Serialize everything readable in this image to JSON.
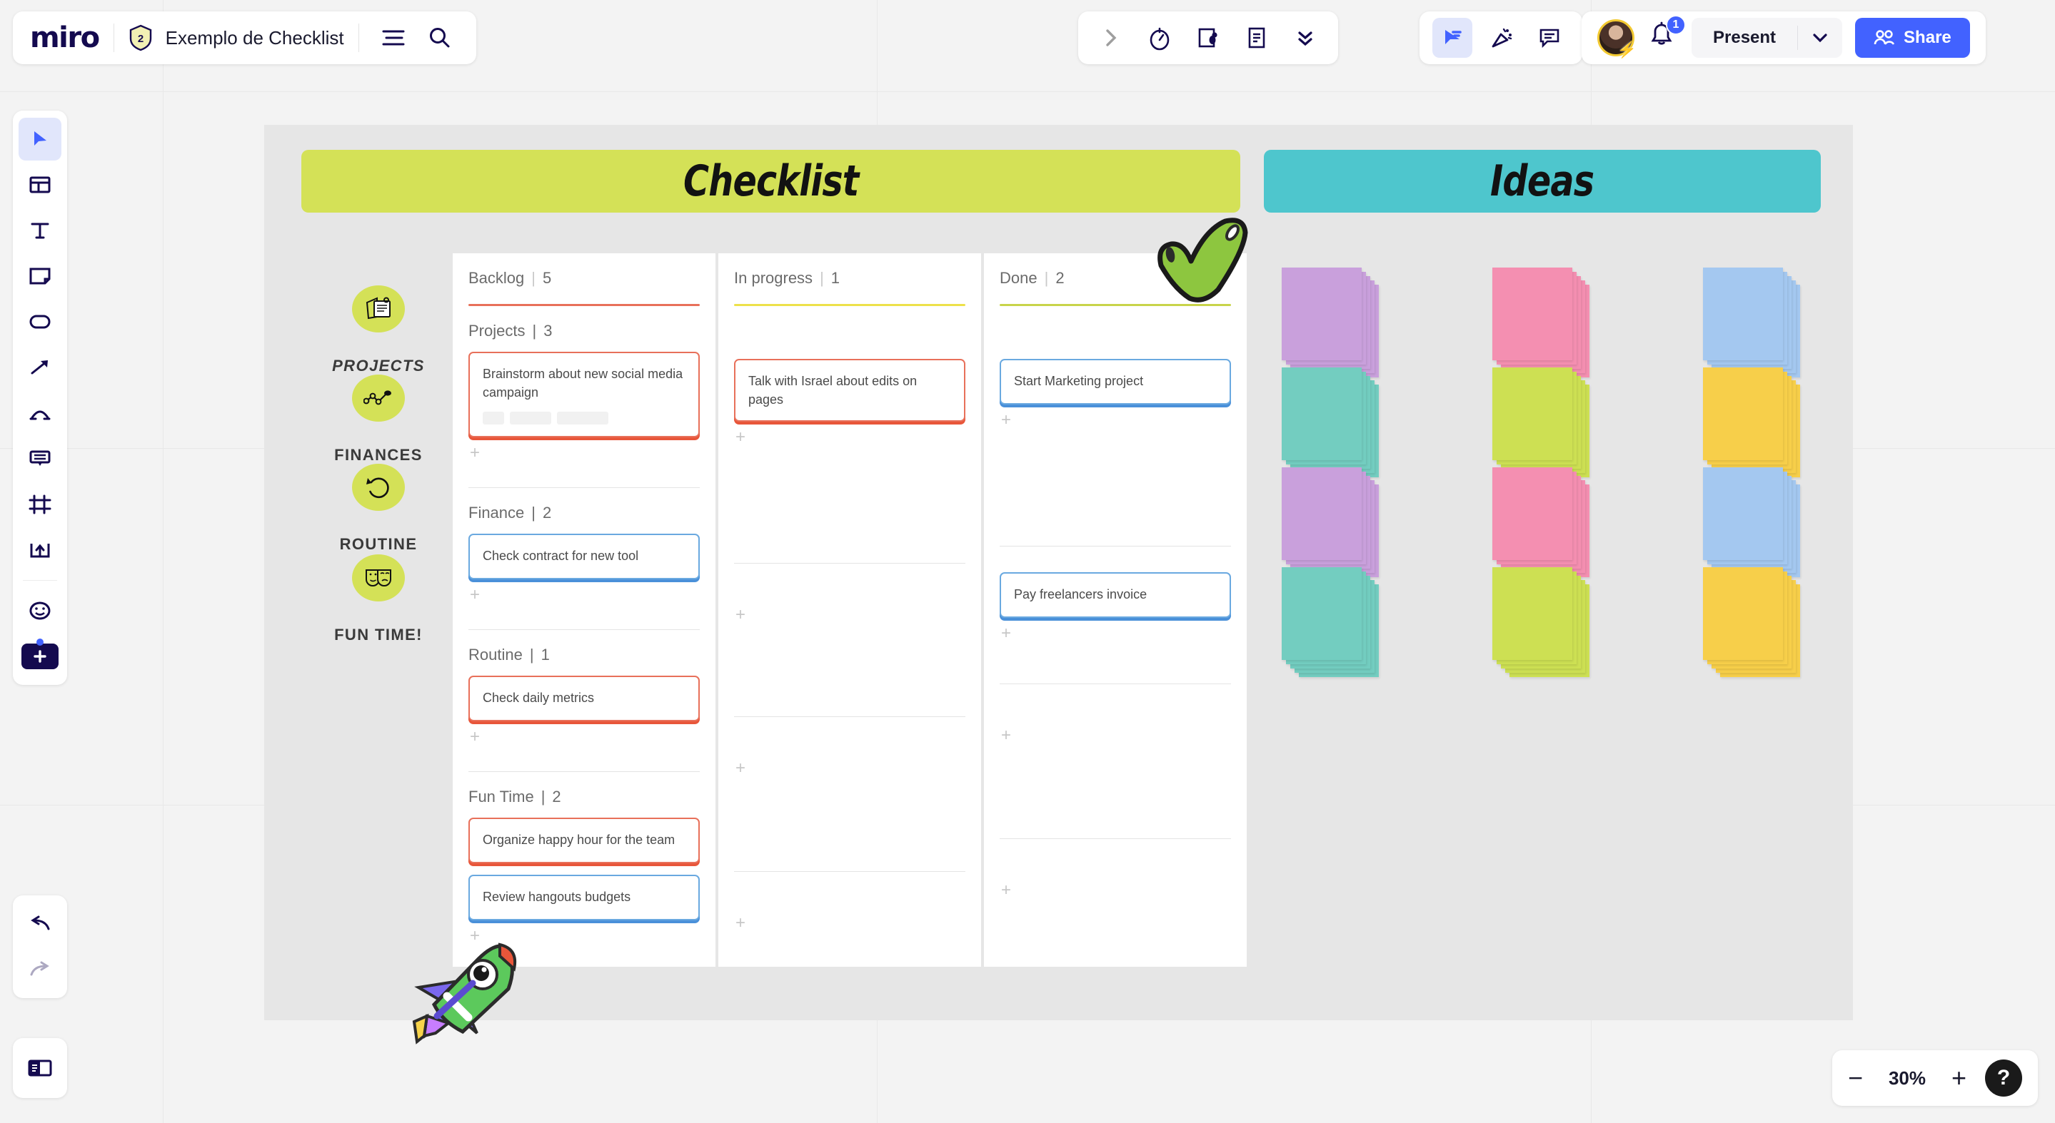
{
  "header": {
    "logo_text": "miro",
    "shield_badge": "2",
    "board_title": "Exemplo de Checklist",
    "menu_icon": "hamburger-menu-icon",
    "search_icon": "search-icon"
  },
  "collab_toolbar": {
    "items": [
      {
        "label": "",
        "icon": "chevron-right-icon"
      },
      {
        "label": "",
        "icon": "timer-icon"
      },
      {
        "label": "",
        "icon": "voting-icon"
      },
      {
        "label": "",
        "icon": "notes-icon"
      },
      {
        "label": "",
        "icon": "chevron-double-down-icon"
      }
    ]
  },
  "tools_toolbar": {
    "items": [
      {
        "label": "",
        "icon": "cursor-select-icon",
        "active": true
      },
      {
        "label": "",
        "icon": "party-popper-icon",
        "active": false
      },
      {
        "label": "",
        "icon": "comment-icon",
        "active": false
      }
    ]
  },
  "account_bar": {
    "avatar_name": "user-avatar",
    "avatar_badge_icon": "lightning-bolt-icon",
    "notification_count": "1",
    "present_label": "Present",
    "present_caret_icon": "chevron-down-icon",
    "share_label": "Share",
    "share_icon": "people-icon",
    "share_color": "#4262ff"
  },
  "left_toolbar": {
    "items": [
      {
        "name": "select-tool",
        "icon": "cursor-icon",
        "active": true
      },
      {
        "name": "templates-tool",
        "icon": "templates-icon",
        "active": false
      },
      {
        "name": "text-tool",
        "icon": "text-icon",
        "active": false
      },
      {
        "name": "sticky-note-tool",
        "icon": "sticky-note-icon",
        "active": false
      },
      {
        "name": "shapes-tool",
        "icon": "rounded-rectangle-icon",
        "active": false
      },
      {
        "name": "connector-tool",
        "icon": "arrow-icon",
        "active": false
      },
      {
        "name": "pen-tool",
        "icon": "pen-draw-icon",
        "active": false
      },
      {
        "name": "comment-tool",
        "icon": "comment-bubble-icon",
        "active": false
      },
      {
        "name": "frame-tool",
        "icon": "frame-icon",
        "active": false
      },
      {
        "name": "upload-tool",
        "icon": "upload-icon",
        "active": false
      },
      {
        "name": "sticker-tool",
        "icon": "emoji-sticker-icon",
        "active": false
      },
      {
        "name": "apps-tool",
        "icon": "plus-apps-icon",
        "active": false
      }
    ],
    "undo_icon": "undo-icon",
    "redo_icon": "redo-icon",
    "panel_icon": "side-panel-icon"
  },
  "zoom_control": {
    "minus_label": "−",
    "zoom_level": "30%",
    "plus_label": "+",
    "help_label": "?"
  },
  "board": {
    "banners": [
      {
        "title": "Checklist",
        "color": "#d4e157"
      },
      {
        "title": "Ideas",
        "color": "#4ec6cd"
      }
    ],
    "categories": [
      {
        "label": "PROJECTS",
        "icon": "sticky-notes-icon",
        "italic": true
      },
      {
        "label": "FINANCES",
        "icon": "line-chart-icon",
        "italic": false
      },
      {
        "label": "ROUTINE",
        "icon": "circular-arrow-icon",
        "italic": false
      },
      {
        "label": "FUN TIME!",
        "icon": "theater-masks-icon",
        "italic": false
      }
    ],
    "columns": [
      {
        "title": "Backlog",
        "divider": "|",
        "count": "5",
        "rule_color": "#e8705a",
        "groups": [
          {
            "title": "Projects",
            "divider": "|",
            "count": "3",
            "cards": [
              {
                "text": "Brainstorm about new social media campaign",
                "border": "coral",
                "tags": 3
              }
            ]
          },
          {
            "title": "Finance",
            "divider": "|",
            "count": "2",
            "cards": [
              {
                "text": "Check contract for new tool",
                "border": "blue",
                "tags": 0
              }
            ]
          },
          {
            "title": "Routine",
            "divider": "|",
            "count": "1",
            "cards": [
              {
                "text": "Check daily metrics",
                "border": "coral",
                "tags": 0
              }
            ]
          },
          {
            "title": "Fun Time",
            "divider": "|",
            "count": "2",
            "cards": [
              {
                "text": "Organize happy hour for the team",
                "border": "coral",
                "tags": 0
              },
              {
                "text": "Review hangouts budgets",
                "border": "blue",
                "tags": 0
              }
            ]
          }
        ]
      },
      {
        "title": "In progress",
        "divider": "|",
        "count": "1",
        "rule_color": "#ede14a",
        "groups": [
          {
            "title": "",
            "divider": "",
            "count": "",
            "cards": [
              {
                "text": "Talk with Israel about edits on pages",
                "border": "coral",
                "tags": 0
              }
            ]
          },
          {
            "title": "",
            "divider": "",
            "count": "",
            "cards": []
          },
          {
            "title": "",
            "divider": "",
            "count": "",
            "cards": []
          },
          {
            "title": "",
            "divider": "",
            "count": "",
            "cards": []
          }
        ]
      },
      {
        "title": "Done",
        "divider": "|",
        "count": "2",
        "rule_color": "#c8d44a",
        "groups": [
          {
            "title": "",
            "divider": "",
            "count": "",
            "cards": [
              {
                "text": "Start Marketing project",
                "border": "blue",
                "tags": 0
              }
            ]
          },
          {
            "title": "",
            "divider": "",
            "count": "",
            "cards": [
              {
                "text": "Pay freelancers invoice",
                "border": "blue",
                "tags": 0
              }
            ]
          },
          {
            "title": "",
            "divider": "",
            "count": "",
            "cards": []
          },
          {
            "title": "",
            "divider": "",
            "count": "",
            "cards": []
          }
        ]
      }
    ],
    "add_card_label": "+",
    "idea_stacks": [
      {
        "color": "#c9a0dc",
        "name": "purple"
      },
      {
        "color": "#f48fb1",
        "name": "pink"
      },
      {
        "color": "#a4c8f0",
        "name": "blue"
      },
      {
        "color": "#73cdc0",
        "name": "teal"
      },
      {
        "color": "#cde053",
        "name": "lime"
      },
      {
        "color": "#f7cf4a",
        "name": "yellow"
      },
      {
        "color": "#c9a0dc",
        "name": "purple"
      },
      {
        "color": "#f48fb1",
        "name": "pink"
      },
      {
        "color": "#a4c8f0",
        "name": "blue"
      },
      {
        "color": "#73cdc0",
        "name": "teal"
      },
      {
        "color": "#cde053",
        "name": "lime"
      },
      {
        "color": "#f7cf4a",
        "name": "yellow"
      }
    ],
    "stickers": [
      {
        "name": "green-checkmark-sticker",
        "color": "#8dc63f"
      },
      {
        "name": "rocket-sticker",
        "color": "#5cc95c"
      }
    ]
  }
}
